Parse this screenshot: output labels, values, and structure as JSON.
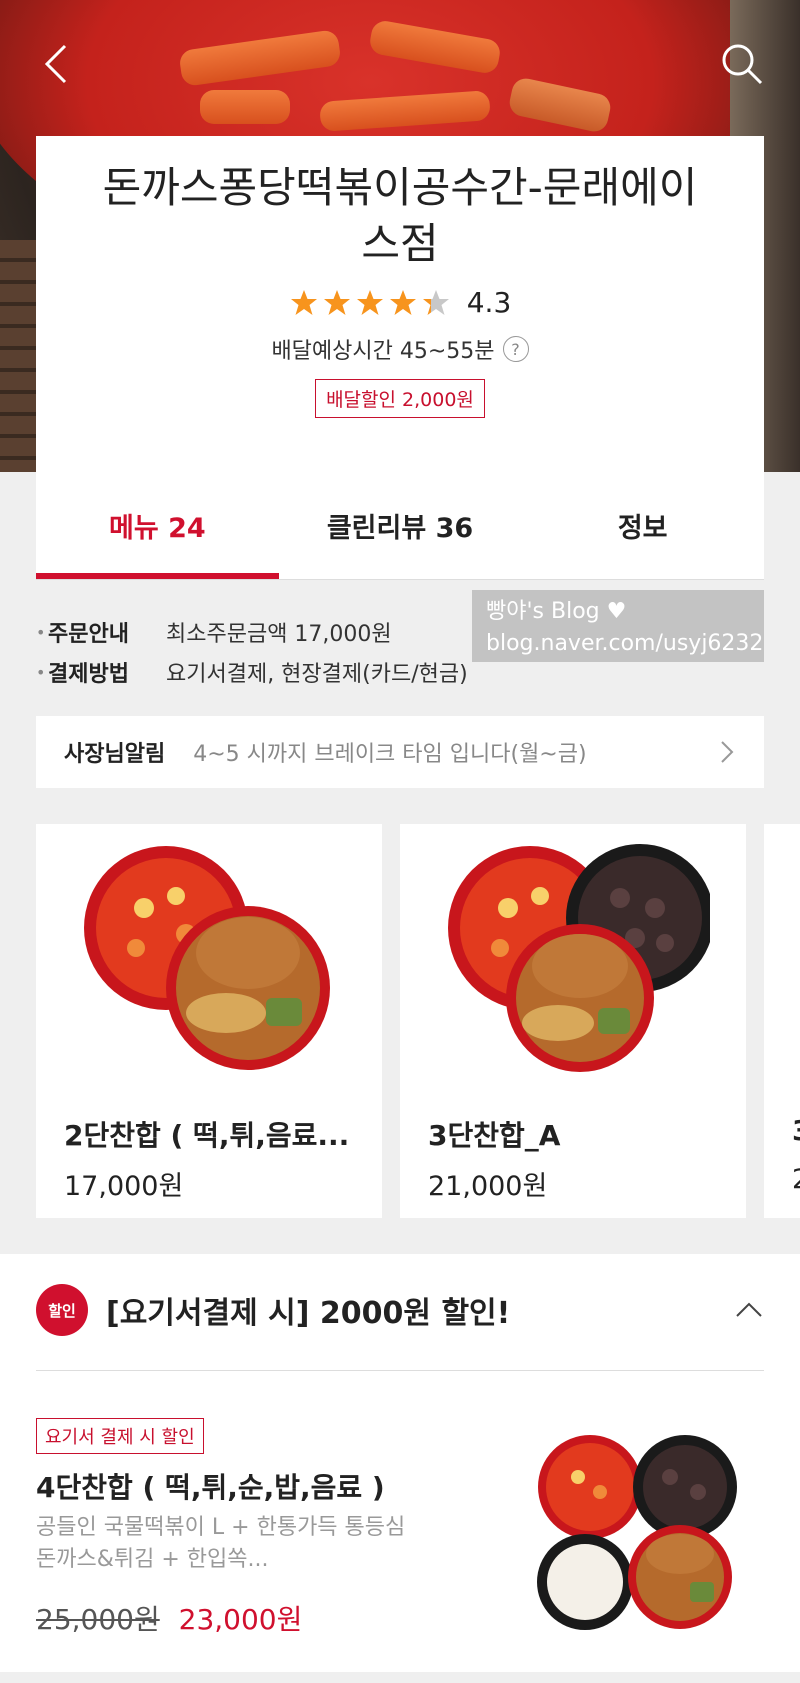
{
  "header": {
    "back_icon": "chevron-left-icon",
    "search_icon": "search-icon"
  },
  "store": {
    "name": "돈까스퐁당떡볶이공수간-문래에이스점",
    "rating": 4.3,
    "rating_text": "4.3",
    "delivery_time": "배달예상시간 45~55분",
    "help": "?",
    "discount": "배달할인 2,000원"
  },
  "tabs": [
    {
      "label": "메뉴 24",
      "active": true
    },
    {
      "label": "클린리뷰 36",
      "active": false
    },
    {
      "label": "정보",
      "active": false
    }
  ],
  "info": {
    "order_label": "주문안내",
    "order_value": "최소주문금액 17,000원",
    "payment_label": "결제방법",
    "payment_value": "요기서결제, 현장결제(카드/현금)"
  },
  "watermark": {
    "line1": "빵야's Blog ♥",
    "line2": "blog.naver.com/usyj6232"
  },
  "notice": {
    "label": "사장님알림",
    "text": "4~5 시까지 브레이크 타임 입니다(월~금)"
  },
  "menu_cards": [
    {
      "name": "2단찬합 ( 떡,튀,음료...",
      "price": "17,000원"
    },
    {
      "name": "3단찬합_A",
      "price": "21,000원"
    },
    {
      "name": "3",
      "price": "2"
    }
  ],
  "promo": {
    "badge": "할인",
    "title": "[요기서결제 시] 2000원 할인!",
    "item": {
      "tag": "요기서 결제 시 할인",
      "name": "4단찬합 ( 떡,튀,순,밥,음료 )",
      "desc": "공들인 국물떡볶이 L + 한통가득 통등심돈까스&튀김 + 한입쏙...",
      "old_price": "25,000원",
      "new_price": "23,000원"
    }
  },
  "colors": {
    "accent": "#d0102e",
    "star": "#f7941d"
  }
}
